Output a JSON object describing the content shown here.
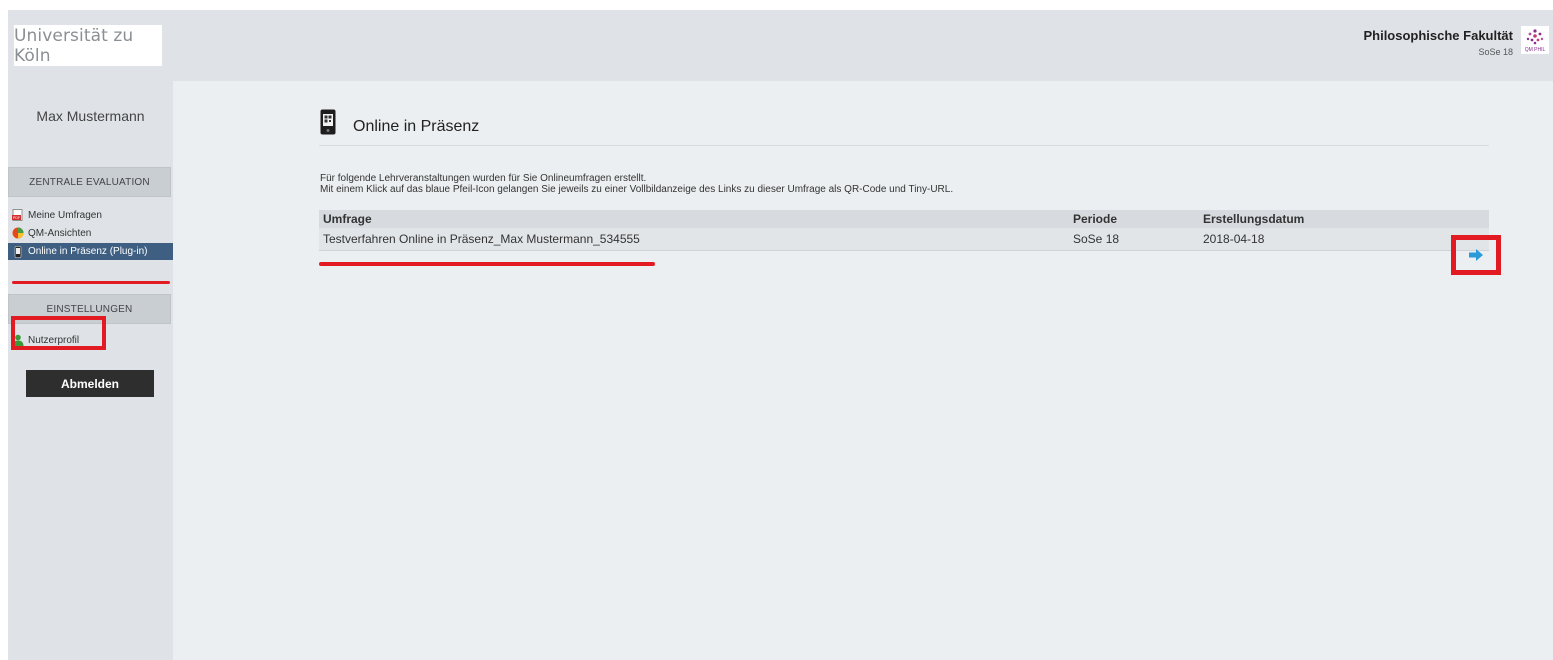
{
  "header": {
    "logo": "Universität zu Köln",
    "faculty": "Philosophische Fakultät",
    "term": "SoSe 18"
  },
  "sidebar": {
    "user": "Max Mustermann",
    "section1": "ZENTRALE EVALUATION",
    "items": [
      {
        "label": "Meine Umfragen",
        "icon": "pdf-icon"
      },
      {
        "label": "QM-Ansichten",
        "icon": "pie-chart-icon"
      },
      {
        "label": "Online in Präsenz (Plug-in)",
        "icon": "smartphone-icon",
        "active": true
      }
    ],
    "section2": "EINSTELLUNGEN",
    "profile": "Nutzerprofil",
    "logout": "Abmelden"
  },
  "main": {
    "title": "Online in Präsenz",
    "intro_line1": "Für folgende Lehrveranstaltungen wurden für Sie Onlineumfragen erstellt.",
    "intro_line2": "Mit einem Klick auf das blaue Pfeil-Icon gelangen Sie jeweils zu einer Vollbildanzeige des Links zu dieser Umfrage als QR-Code und Tiny-URL.",
    "table": {
      "headers": [
        "Umfrage",
        "Periode",
        "Erstellungsdatum"
      ],
      "rows": [
        {
          "survey": "Testverfahren Online in Präsenz_Max Mustermann_534555",
          "period": "SoSe 18",
          "date": "2018-04-18"
        }
      ]
    }
  },
  "colors": {
    "accent_blue": "#3e5e82",
    "highlight_red": "#e21b23",
    "arrow_blue": "#2a9ad8"
  }
}
